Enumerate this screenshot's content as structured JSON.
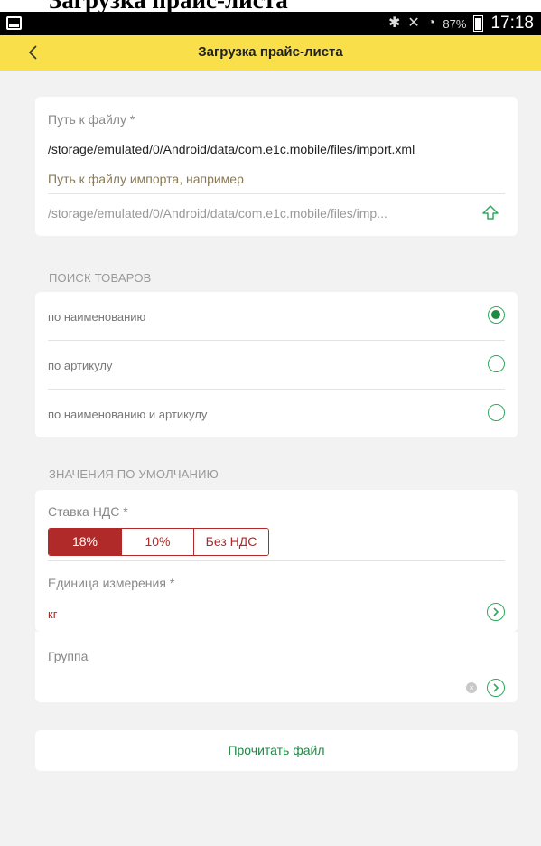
{
  "window": {
    "cut_title": "Загрузка прайс-листа"
  },
  "statusbar": {
    "battery": "87%",
    "time": "17:18"
  },
  "appbar": {
    "title": "Загрузка прайс-листа"
  },
  "file_card": {
    "path_label": "Путь к файлу *",
    "path_value": "/storage/emulated/0/Android/data/com.e1c.mobile/files/import.xml",
    "hint": "Путь к файлу импорта, например",
    "input_value": "/storage/emulated/0/Android/data/com.e1c.mobile/files/imp..."
  },
  "search": {
    "title": "ПОИСК ТОВАРОВ",
    "options": [
      {
        "label": "по наименованию",
        "selected": true
      },
      {
        "label": "по артикулу",
        "selected": false
      },
      {
        "label": "по наименованию и артикулу",
        "selected": false
      }
    ]
  },
  "defaults": {
    "title": "ЗНАЧЕНИЯ ПО УМОЛЧАНИЮ",
    "vat_label": "Ставка НДС *",
    "vat_options": [
      "18%",
      "10%",
      "Без НДС"
    ],
    "vat_selected": "18%",
    "unit_label": "Единица измерения *",
    "unit_value": "кг",
    "group_label": "Группа"
  },
  "actions": {
    "read_button": "Прочитать файл"
  },
  "colors": {
    "accent": "#f9e04a",
    "green": "#1f8a44",
    "red": "#b02a2a"
  }
}
